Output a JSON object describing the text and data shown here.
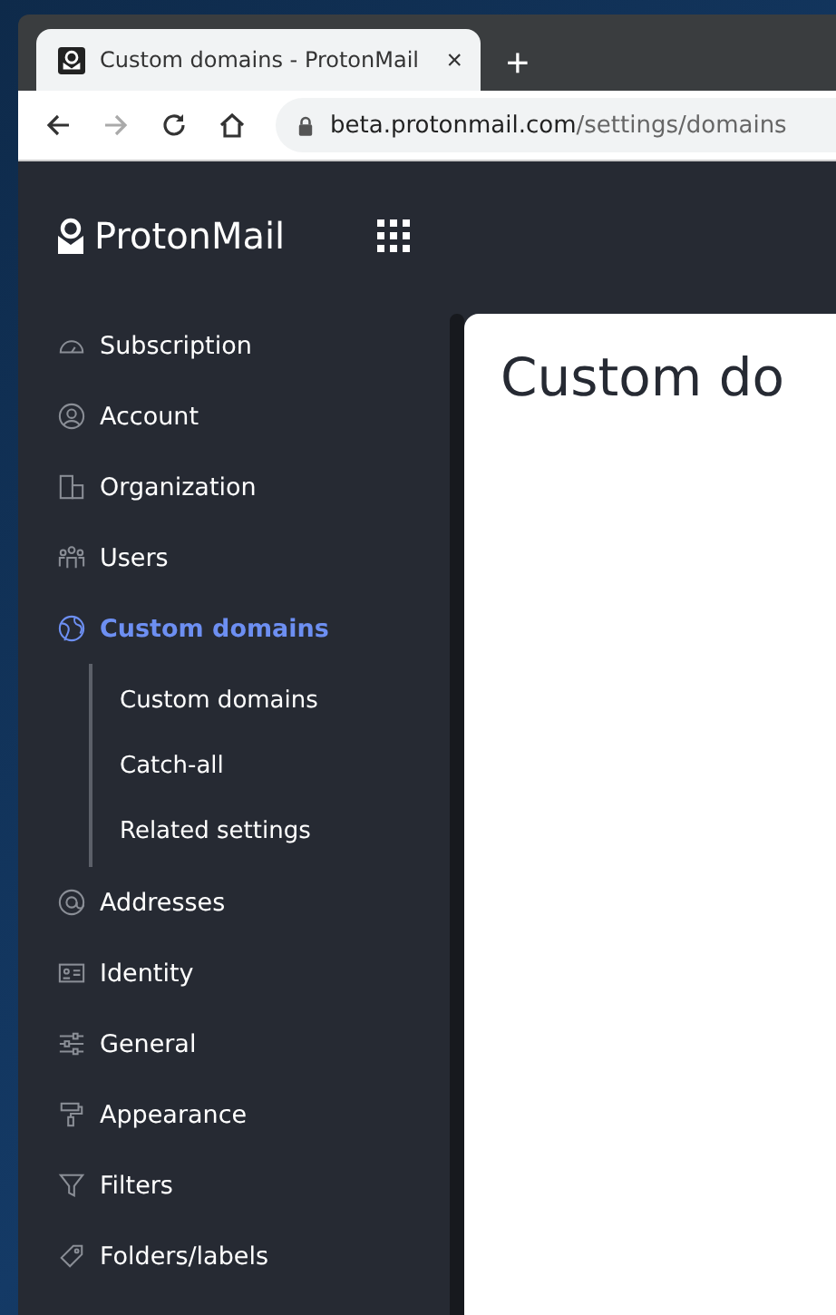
{
  "browser": {
    "tab": {
      "title": "Custom domains - ProtonMail",
      "close": "×"
    },
    "new_tab": "+",
    "url": {
      "host": "beta.protonmail.com",
      "path": "/settings/domains"
    }
  },
  "app": {
    "logo": "ProtonMail"
  },
  "sidebar": {
    "items": [
      {
        "label": "Subscription",
        "kind": "gauge",
        "selected": false
      },
      {
        "label": "Account",
        "kind": "user",
        "selected": false
      },
      {
        "label": "Organization",
        "kind": "building",
        "selected": false
      },
      {
        "label": "Users",
        "kind": "users",
        "selected": false
      },
      {
        "label": "Custom domains",
        "kind": "globe",
        "selected": true,
        "children": [
          {
            "label": "Custom domains"
          },
          {
            "label": "Catch-all"
          },
          {
            "label": "Related settings"
          }
        ]
      },
      {
        "label": "Addresses",
        "kind": "at",
        "selected": false
      },
      {
        "label": "Identity",
        "kind": "card",
        "selected": false
      },
      {
        "label": "General",
        "kind": "sliders",
        "selected": false
      },
      {
        "label": "Appearance",
        "kind": "roller",
        "selected": false
      },
      {
        "label": "Filters",
        "kind": "filter",
        "selected": false
      },
      {
        "label": "Folders/labels",
        "kind": "tag",
        "selected": false
      }
    ]
  },
  "content": {
    "title": "Custom do"
  }
}
